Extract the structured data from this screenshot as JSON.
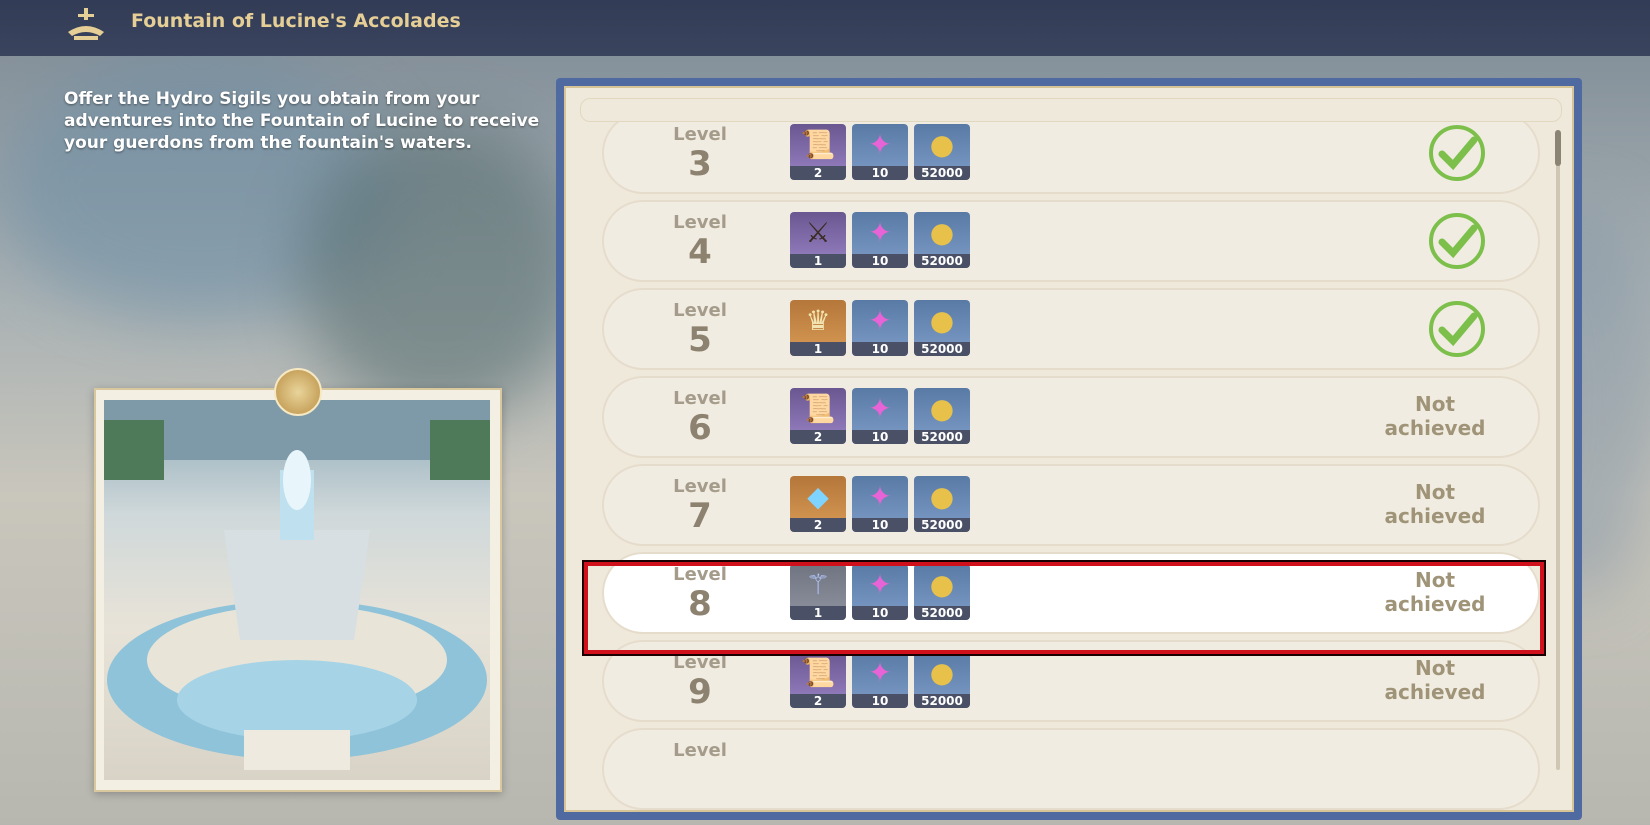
{
  "header": {
    "title": "Fountain of Lucine's Accolades",
    "icon": "fountain-icon"
  },
  "description": "Offer the Hydro Sigils you obtain from your adventures into the Fountain of Lucine to receive your guerdons from the fountain's waters.",
  "level_word": "Level",
  "rewards": [
    {
      "level": "3",
      "status": "achieved",
      "items": [
        {
          "icon": "scroll-icon",
          "count": "2",
          "rarity": "purple"
        },
        {
          "icon": "crystal-icon",
          "count": "10",
          "rarity": "blue"
        },
        {
          "icon": "mora-coin-icon",
          "count": "52000",
          "rarity": "blue"
        }
      ]
    },
    {
      "level": "4",
      "status": "achieved",
      "items": [
        {
          "icon": "sword-icon",
          "count": "1",
          "rarity": "purple"
        },
        {
          "icon": "crystal-icon",
          "count": "10",
          "rarity": "blue"
        },
        {
          "icon": "mora-coin-icon",
          "count": "52000",
          "rarity": "blue"
        }
      ]
    },
    {
      "level": "5",
      "status": "achieved",
      "items": [
        {
          "icon": "crown-icon",
          "count": "1",
          "rarity": "orange"
        },
        {
          "icon": "crystal-icon",
          "count": "10",
          "rarity": "blue"
        },
        {
          "icon": "mora-coin-icon",
          "count": "52000",
          "rarity": "blue"
        }
      ]
    },
    {
      "level": "6",
      "status_text": "Not achieved",
      "items": [
        {
          "icon": "scroll-icon",
          "count": "2",
          "rarity": "purple"
        },
        {
          "icon": "crystal-icon",
          "count": "10",
          "rarity": "blue"
        },
        {
          "icon": "mora-coin-icon",
          "count": "52000",
          "rarity": "blue"
        }
      ]
    },
    {
      "level": "7",
      "status_text": "Not achieved",
      "items": [
        {
          "icon": "hydro-gem-icon",
          "count": "2",
          "rarity": "orange"
        },
        {
          "icon": "crystal-icon",
          "count": "10",
          "rarity": "blue"
        },
        {
          "icon": "mora-coin-icon",
          "count": "52000",
          "rarity": "blue"
        }
      ]
    },
    {
      "level": "8",
      "status_text": "Not achieved",
      "highlighted": true,
      "items": [
        {
          "icon": "branch-icon",
          "count": "1",
          "rarity": "gray"
        },
        {
          "icon": "crystal-icon",
          "count": "10",
          "rarity": "blue"
        },
        {
          "icon": "mora-coin-icon",
          "count": "52000",
          "rarity": "blue"
        }
      ]
    },
    {
      "level": "9",
      "status_text": "Not achieved",
      "items": [
        {
          "icon": "scroll-icon",
          "count": "2",
          "rarity": "purple"
        },
        {
          "icon": "crystal-icon",
          "count": "10",
          "rarity": "blue"
        },
        {
          "icon": "mora-coin-icon",
          "count": "52000",
          "rarity": "blue"
        }
      ]
    },
    {
      "level": "",
      "status_text": "",
      "partial": true,
      "items": []
    }
  ],
  "colors": {
    "highlight_border": "#d0101a",
    "check_green": "#7cc04b",
    "title_gold": "#e6cf96"
  }
}
